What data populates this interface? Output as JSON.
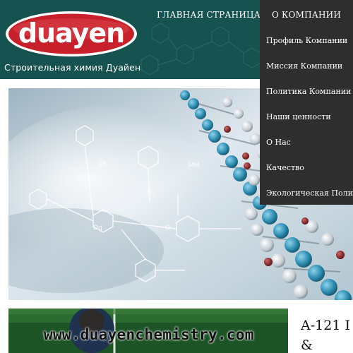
{
  "brand": {
    "logo_text": "duayen",
    "tagline": "Строительная химия Дуайен"
  },
  "nav": {
    "home": "ГЛАВНАЯ СТРАНИЦА",
    "about": "О КОМПАНИИ"
  },
  "dropdown": {
    "items": [
      "Профиль Компании",
      "Миссия Компании",
      "Политика Компании",
      "Наши ценности",
      "О Нас",
      "Качество",
      "Экологическая Политика"
    ]
  },
  "lower": {
    "product_heading": "A-121 I",
    "product_heading_line2": "&",
    "watermark": "www.duayenchemistry.com"
  },
  "colors": {
    "header_bg": "#16524f",
    "menu_bg": "#2e2e2e",
    "logo_red": "#c8202a"
  }
}
